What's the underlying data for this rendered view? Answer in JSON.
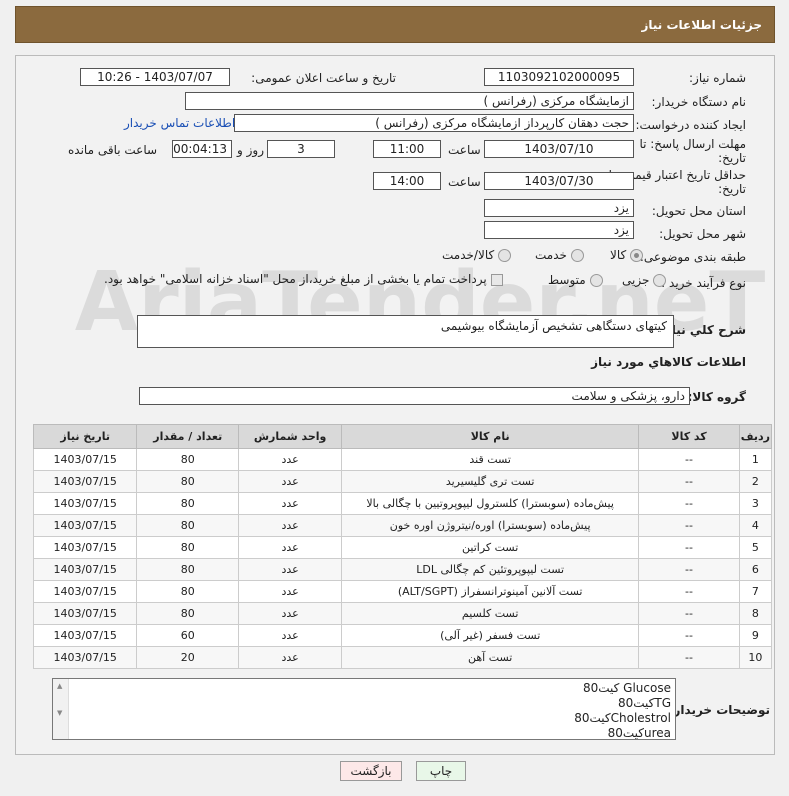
{
  "header": {
    "title": "جزئیات اطلاعات نیاز"
  },
  "form": {
    "need_number_label": "شماره نیاز:",
    "need_number": "1103092102000095",
    "announce_label": "تاریخ و ساعت اعلان عمومی:",
    "announce_value": "1403/07/07 - 10:26",
    "buyer_org_label": "نام دستگاه خریدار:",
    "buyer_org": "ازمایشگاه مرکزی (رفرانس )",
    "requester_label": "ایجاد کننده درخواست:",
    "requester": "حجت دهقان کارپرداز ازمایشگاه مرکزی (رفرانس )",
    "contact_link": "اطلاعات تماس خریدار",
    "deadline_label_1": "مهلت ارسال پاسخ: تا",
    "deadline_label_2": "تاریخ:",
    "deadline_date": "1403/07/10",
    "time_label": "ساعت",
    "deadline_time": "11:00",
    "days_value": "3",
    "days_label": "روز و",
    "remaining_value": "00:04:13",
    "remaining_label": "ساعت باقی مانده",
    "validity_label_1": "حداقل تاریخ اعتبار قیمت: تا",
    "validity_label_2": "تاریخ:",
    "validity_date": "1403/07/30",
    "validity_time": "14:00",
    "province_label": "استان محل تحویل:",
    "province": "یزد",
    "city_label": "شهر محل تحویل:",
    "city": "یزد",
    "category_label": "طبقه بندی موضوعی:",
    "category_options": [
      "کالا",
      "خدمت",
      "کالا/خدمت"
    ],
    "process_label": "نوع فرآیند خرید :",
    "process_options": [
      "جزیی",
      "متوسط"
    ],
    "payment_note": "پرداخت تمام یا بخشی از مبلغ خرید،از محل \"اسناد خزانه اسلامی\" خواهد بود.",
    "summary_label": "شرح كلي نياز:",
    "summary": "کیتهای دستگاهی تشخیص آزمایشگاه بیوشیمی",
    "items_section_title": "اطلاعات كالاهاي مورد نياز",
    "group_label": "گروه کالا:",
    "group_value": "دارو، پزشکی و سلامت"
  },
  "table": {
    "headers": [
      "ردیف",
      "کد کالا",
      "نام کالا",
      "واحد شمارش",
      "تعداد / مقدار",
      "تاریخ نیاز"
    ],
    "rows": [
      [
        "1",
        "--",
        "تست قند",
        "عدد",
        "80",
        "1403/07/15"
      ],
      [
        "2",
        "--",
        "تست تری گلیسیرید",
        "عدد",
        "80",
        "1403/07/15"
      ],
      [
        "3",
        "--",
        "پیش‌ماده (سوبسترا) کلسترول لیپوپروتیین با چگالی بالا",
        "عدد",
        "80",
        "1403/07/15"
      ],
      [
        "4",
        "--",
        "پیش‌ماده (سوبسترا) اوره/نیتروژن اوره خون",
        "عدد",
        "80",
        "1403/07/15"
      ],
      [
        "5",
        "--",
        "تست کراتین",
        "عدد",
        "80",
        "1403/07/15"
      ],
      [
        "6",
        "--",
        "تست لیپوپروتئین کم چگالی LDL",
        "عدد",
        "80",
        "1403/07/15"
      ],
      [
        "7",
        "--",
        "تست آلانین آمینوترانسفراز (ALT/SGPT)",
        "عدد",
        "80",
        "1403/07/15"
      ],
      [
        "8",
        "--",
        "تست کلسیم",
        "عدد",
        "80",
        "1403/07/15"
      ],
      [
        "9",
        "--",
        "تست فسفر (غیر آلی)",
        "عدد",
        "60",
        "1403/07/15"
      ],
      [
        "10",
        "--",
        "تست آهن",
        "عدد",
        "20",
        "1403/07/15"
      ]
    ]
  },
  "buyer_notes": {
    "label": "توضیحات خریدار:",
    "lines": [
      "80کیت  Glucose",
      "80کیتTG",
      "80کیتCholestrol",
      "80کیتurea"
    ]
  },
  "buttons": {
    "print": "چاپ",
    "back": "بازگشت"
  },
  "watermark": "AriaTender.neT",
  "colors": {
    "header_bg": "#8b6a3e",
    "link": "#1a4fb5",
    "back_button_bg": "#fde8e8",
    "print_button_bg": "#e8f7e8"
  }
}
